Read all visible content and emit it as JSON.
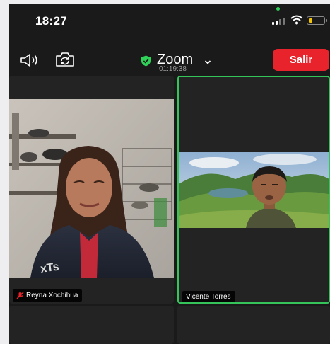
{
  "status_bar": {
    "time": "18:27"
  },
  "top_bar": {
    "audio_icon": "speaker-icon",
    "camera_switch_icon": "camera-switch-icon",
    "meeting_title": "Zoom",
    "security_icon": "shield-check-icon",
    "elapsed_time": "01:19:38",
    "leave_label": "Salir"
  },
  "participants": [
    {
      "name": "Reyna Xochihua",
      "muted": true,
      "active_speaker": false
    },
    {
      "name": "Vicente Torres",
      "muted": false,
      "active_speaker": true
    }
  ],
  "colors": {
    "leave_button": "#e8232c",
    "active_speaker_border": "#35c45a",
    "security_shield": "#2fd158",
    "battery_level": "#f5c400"
  }
}
